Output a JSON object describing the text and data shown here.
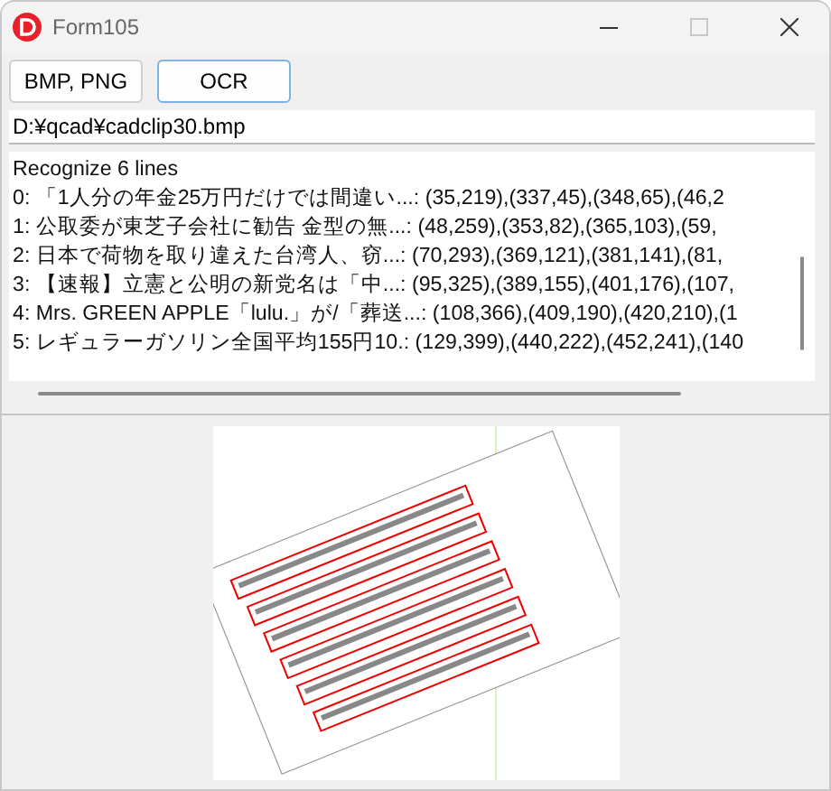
{
  "window": {
    "title": "Form105",
    "maximize_disabled": true
  },
  "buttons": [
    {
      "label": "BMP, PNG",
      "focused": false
    },
    {
      "label": "OCR",
      "focused": true
    }
  ],
  "path_field": {
    "value": "D:¥qcad¥cadclip30.bmp"
  },
  "output": {
    "lines": [
      "Recognize 6 lines",
      "0: 「1人分の年金25万円だけでは間違い...: (35,219),(337,45),(348,65),(46,2",
      "1: 公取委が東芝子会社に勧告 金型の無...: (48,259),(353,82),(365,103),(59,",
      "2: 日本で荷物を取り違えた台湾人、窃...: (70,293),(369,121),(381,141),(81,",
      "3: 【速報】立憲と公明の新党名は「中...: (95,325),(389,155),(401,176),(107,",
      "4: Mrs. GREEN APPLE「lulu.」が/「葬送...: (108,366),(409,190),(420,210),(1",
      "5: レギュラーガソリン全国平均155円10.: (129,399),(440,222),(452,241),(140"
    ]
  }
}
